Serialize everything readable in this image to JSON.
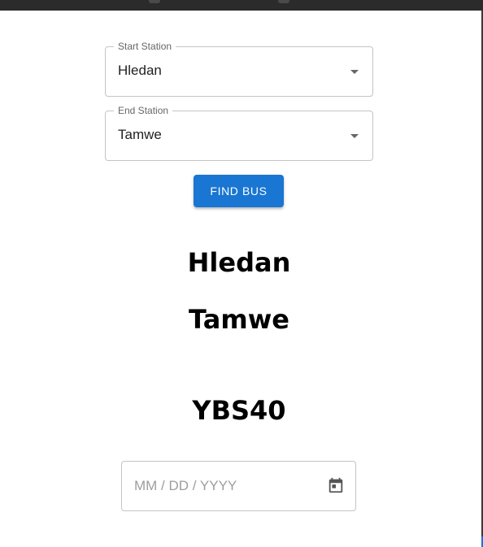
{
  "form": {
    "start_station": {
      "label": "Start Station",
      "value": "Hledan"
    },
    "end_station": {
      "label": "End Station",
      "value": "Tamwe"
    },
    "find_button_label": "FIND BUS",
    "accent_color": "#1976d2"
  },
  "results": {
    "from": "Hledan",
    "to": "Tamwe",
    "bus": "YBS40"
  },
  "date_input": {
    "placeholder": "MM / DD / YYYY",
    "icon": "calendar-icon"
  }
}
